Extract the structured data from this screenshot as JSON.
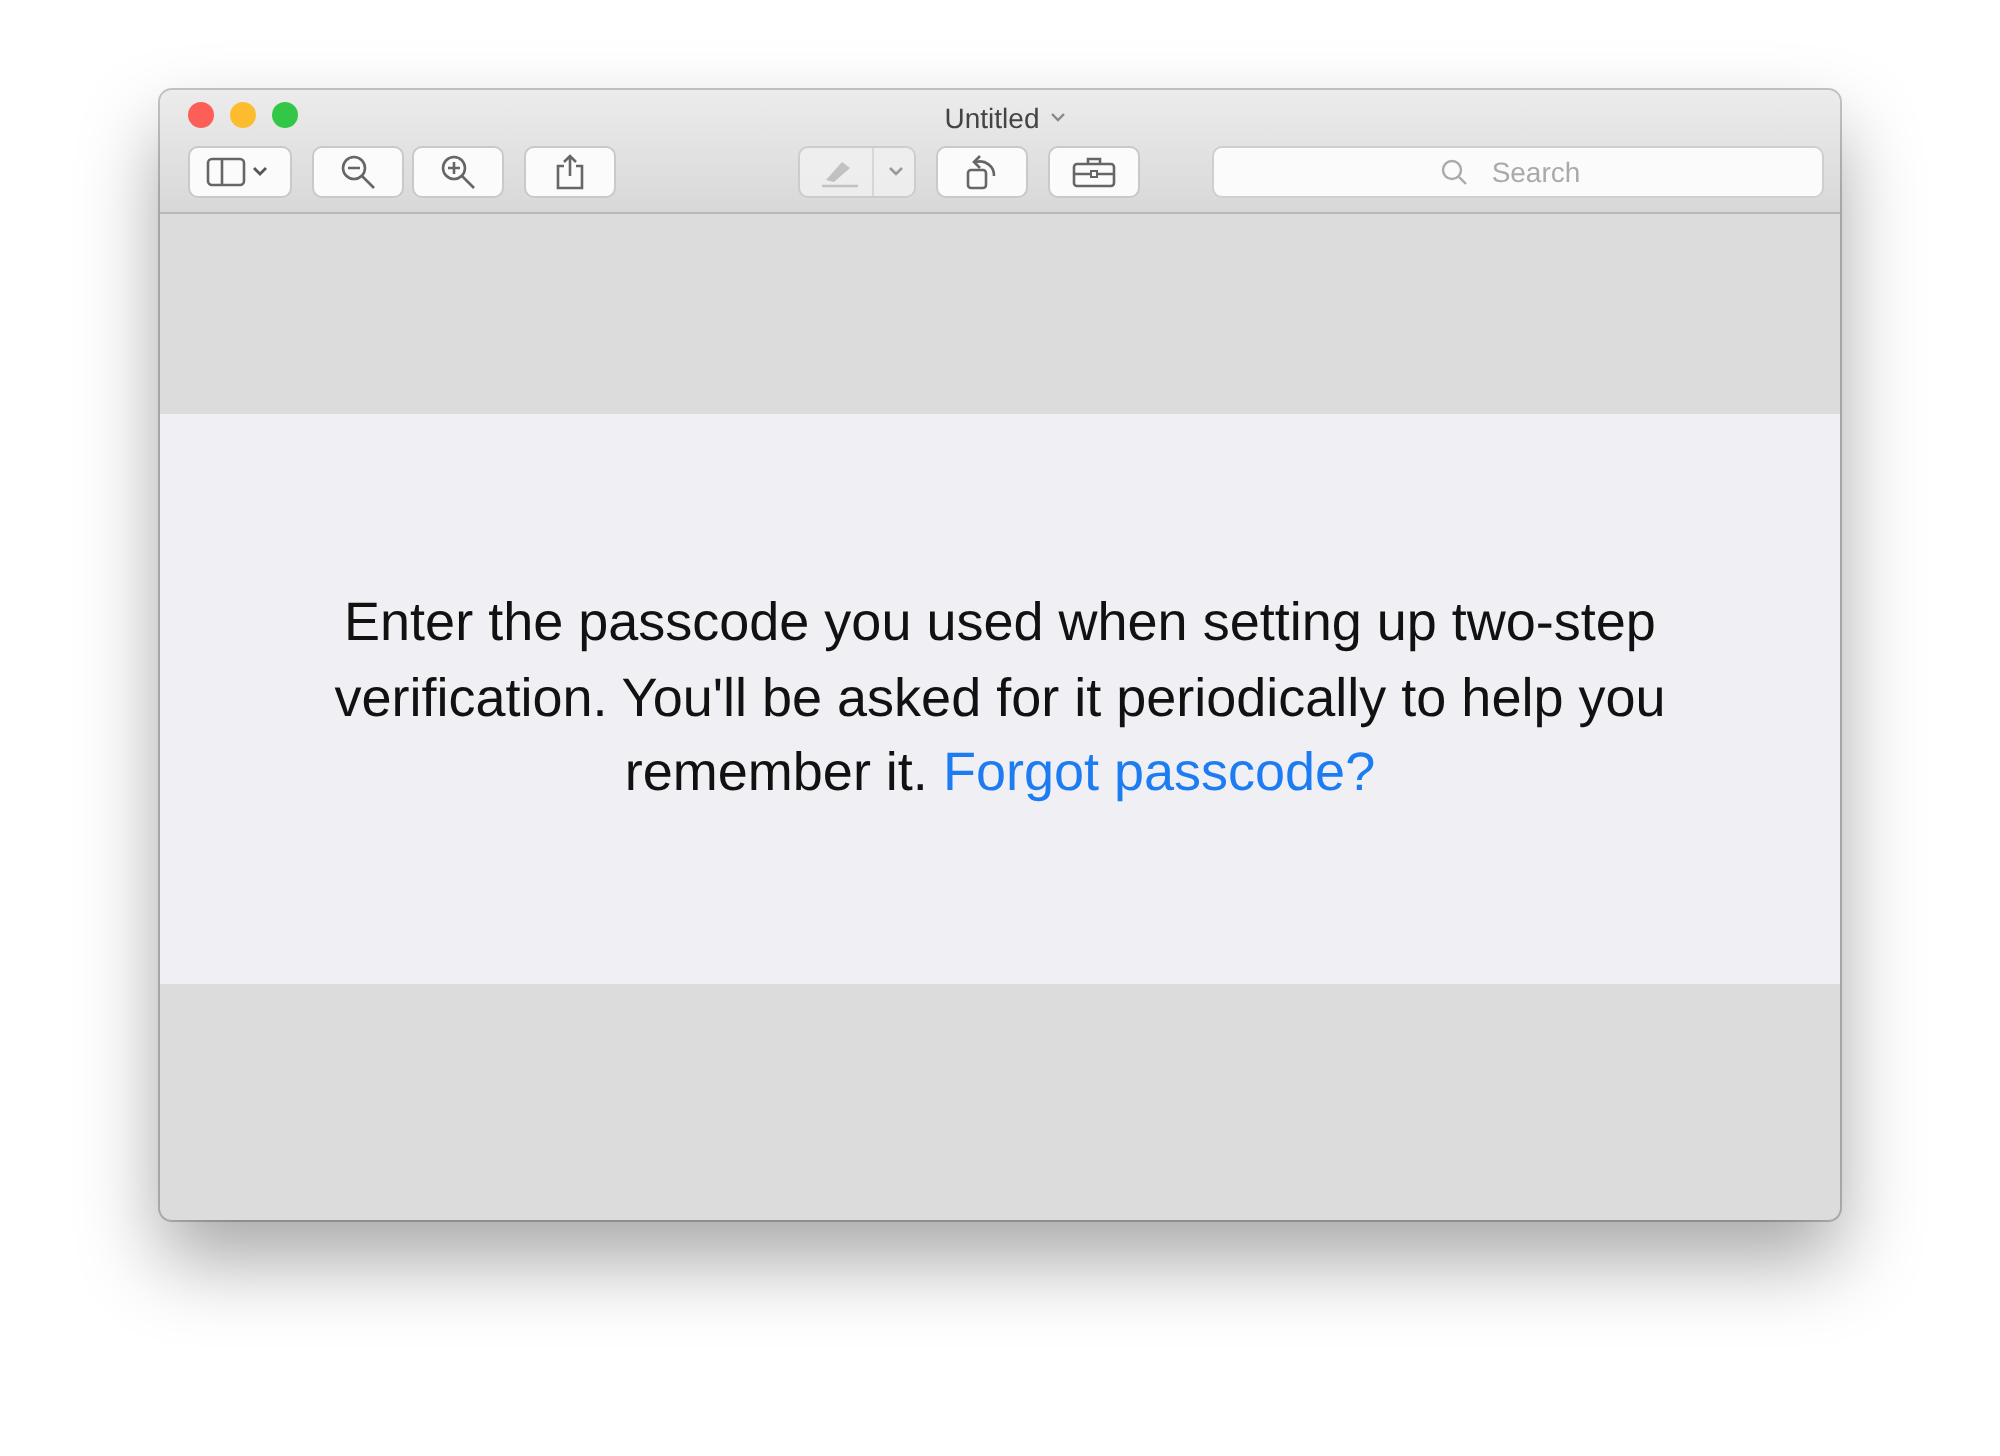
{
  "window": {
    "title": "Untitled"
  },
  "toolbar": [
    {
      "kind": "sidebar"
    },
    {
      "kind": "zoom-out"
    },
    {
      "kind": "zoom-in"
    },
    {
      "kind": "share"
    },
    {
      "kind": "markup",
      "disabled": true
    },
    {
      "kind": "rotate"
    },
    {
      "kind": "toolbox"
    }
  ],
  "search": {
    "placeholder": "Search"
  },
  "message": {
    "text": "Enter the passcode you used when setting up two-step verification. You'll be asked for it periodically to help you remember it. ",
    "link": "Forgot passcode?"
  }
}
